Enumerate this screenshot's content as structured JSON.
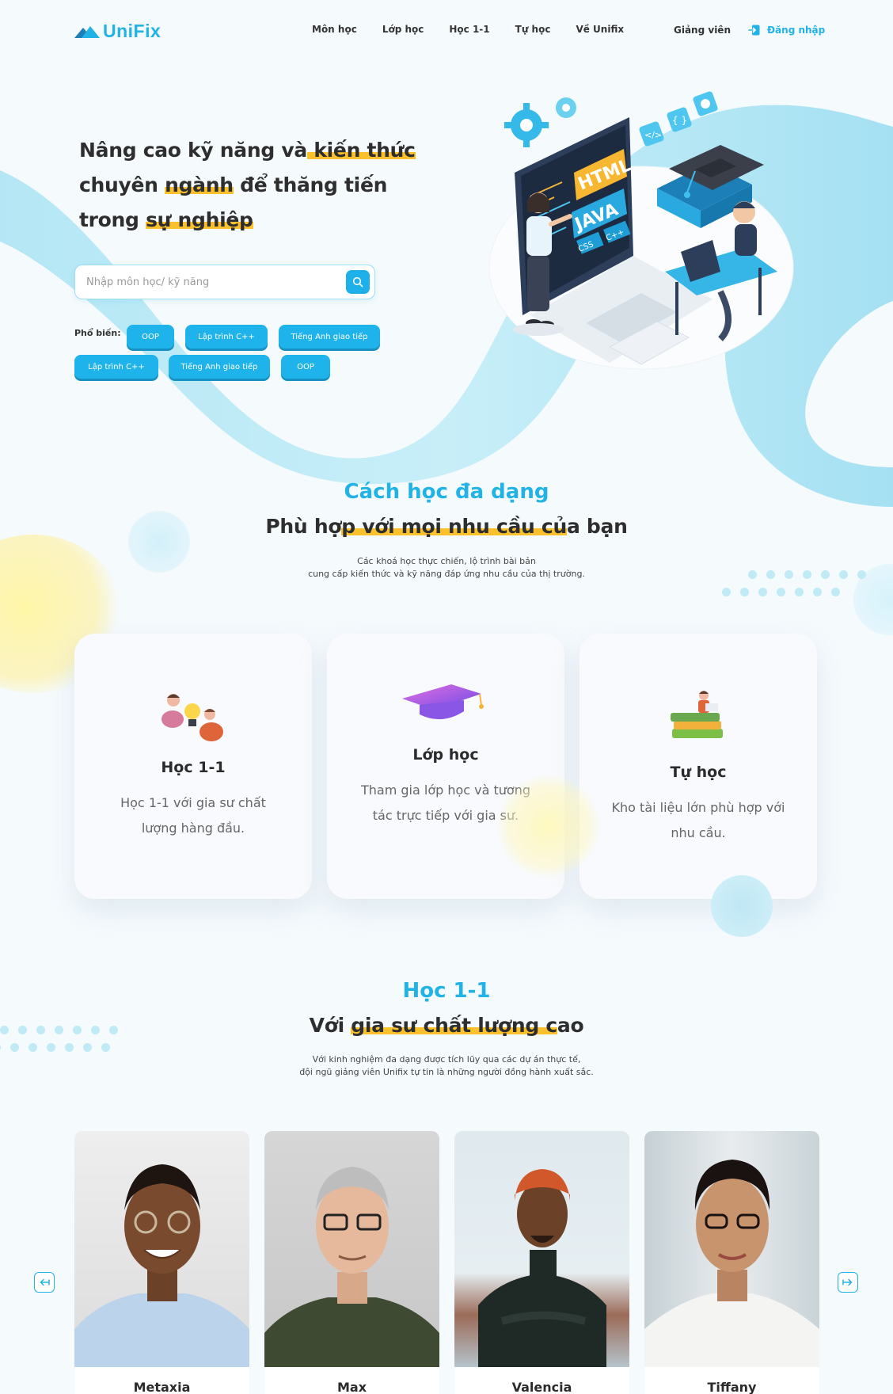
{
  "brand": {
    "name": "UniFix",
    "accent": "#22b3e6",
    "highlight": "#fbc12d"
  },
  "nav": {
    "links": [
      "Môn học",
      "Lớp học",
      "Học 1-1",
      "Tự học",
      "Về Unifix"
    ],
    "teacher": "Giảng viên",
    "login": "Đăng nhập",
    "login_icon": "login-icon"
  },
  "hero": {
    "line1_a": "Nâng cao kỹ năng và",
    "line1_b": " kiến thức",
    "line2_a": "chuyên ",
    "line2_b": "ngành",
    "line2_c": " để thăng tiến",
    "line3_a": "trong ",
    "line3_b": "sự nghiệp",
    "search_placeholder": "Nhập môn học/ kỹ năng",
    "search_icon": "search-icon",
    "popular_label": "Phổ biến:",
    "tags": [
      "OOP",
      "Lập trình C++",
      "Tiếng Anh giao tiếp",
      "Lập trình C++",
      "Tiếng Anh giao tiếp",
      "OOP"
    ],
    "illustration_labels": [
      "HTML",
      "JAVA",
      "CSS",
      "C++",
      "</>",
      "{ }"
    ]
  },
  "methods": {
    "kicker": "Cách học đa dạng",
    "title_a": "Phù hợ",
    "title_b": "p với mọi nhu cầu củ",
    "title_c": "a bạn",
    "desc_line1": "Các khoá học thực chiến, lộ trình bài bản",
    "desc_line2": "cung cấp kiến thức và kỹ năng đáp ứng nhu cầu của thị trường.",
    "cards": [
      {
        "title": "Học 1-1",
        "desc": "Học 1-1 với gia sư chất lượng hàng đầu.",
        "icon": "people-lightbulb-icon"
      },
      {
        "title": "Lớp học",
        "desc": "Tham gia lớp học và tương tác trực tiếp với gia sư.",
        "icon": "graduation-cap-icon"
      },
      {
        "title": "Tự học",
        "desc": "Kho tài liệu lớn phù hợp với nhu cầu.",
        "icon": "reading-on-books-icon"
      }
    ]
  },
  "tutors": {
    "kicker": "Học 1-1",
    "title_a": "Với ",
    "title_b": "gia sư chất lượng c",
    "title_c": "ao",
    "desc_line1": "Với kinh nghiệm đa dạng được tích lũy qua các dự án thực tế,",
    "desc_line2": "đội ngũ giảng viên Unifix tự tin là những người đồng hành xuất sắc.",
    "people": [
      {
        "name": "Metaxia"
      },
      {
        "name": "Max"
      },
      {
        "name": "Valencia"
      },
      {
        "name": "Tiffany"
      }
    ],
    "prev_icon": "arrow-left-icon",
    "next_icon": "arrow-right-icon"
  }
}
